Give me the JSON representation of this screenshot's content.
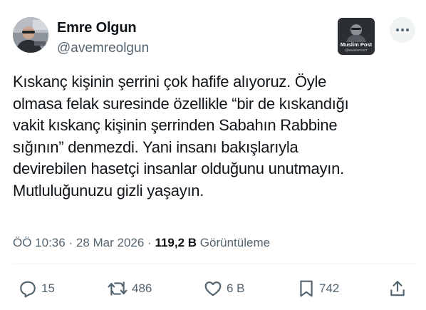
{
  "author": {
    "name": "Emre Olgun",
    "handle": "@avemreolgun"
  },
  "watermark": {
    "brand": "Muslim Post",
    "sub": "@MuslimPOST"
  },
  "tweet": {
    "lines": [
      "Kıskanç kişinin şerrini çok hafife alıyoruz. Öyle",
      "olmasa felak suresinde özellikle “bir de kıskandığı",
      "vakit kıskanç kişinin şerrinden Sabahın Rabbine",
      "sığının” denmezdi. Yani insanı bakışlarıyla",
      "devirebilen hasetçi insanlar olduğunu unutmayın.",
      "Mutluluğunuzu gizli yaşayın."
    ]
  },
  "meta": {
    "time": "ÖÖ 10:36",
    "separator": "·",
    "date": "28 Mar 2026",
    "views_count": "119,2 B",
    "views_label": "Görüntüleme"
  },
  "actions": {
    "reply": {
      "icon": "reply-icon",
      "count": "15"
    },
    "retweet": {
      "icon": "retweet-icon",
      "count": "486"
    },
    "like": {
      "icon": "heart-icon",
      "count": "6 B"
    },
    "bookmark": {
      "icon": "bookmark-icon",
      "count": "742"
    },
    "share": {
      "icon": "share-icon"
    }
  },
  "colors": {
    "text_primary": "#0f1419",
    "text_secondary": "#536471",
    "divider": "#eff3f4"
  }
}
